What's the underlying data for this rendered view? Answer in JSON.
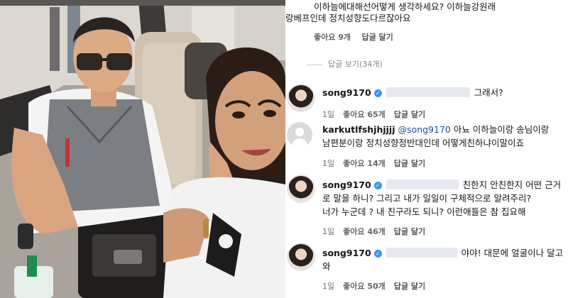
{
  "top_comment": {
    "line1": "이하늘에대해선어떻게 생각하세요? 이하늘강원래",
    "line2": "랑베프인데 정치성향도다르잖아요",
    "likes": "좋아요 9개",
    "reply": "답글 달기"
  },
  "view_replies": "답글 보기(34개)",
  "replies": [
    {
      "username": "song9170",
      "verified": true,
      "text_lines": [
        "그래서?"
      ],
      "time": "1일",
      "likes": "좋아요 65개",
      "reply": "답글 달기"
    },
    {
      "username": "karkutlfshjhjjjj",
      "verified": false,
      "mention": "@song9170",
      "text_lines": [
        "아뇨 이하늘이랑 송님이랑",
        "남편분이랑 정치성향정반대인데 어떻게친하냐이말이죠"
      ],
      "time": "1일",
      "likes": "좋아요 14개",
      "reply": "답글 달기"
    },
    {
      "username": "song9170",
      "verified": true,
      "text_lines": [
        "친한지 안친한지 어떤 근거",
        "로 말을 하니? 그리고 내가 일일이 구체적으로 알려주리?",
        "너가 누군데 ? 내 친구라도 되니? 이런애들은 참 집요해"
      ],
      "time": "1일",
      "likes": "좋아요 46개",
      "reply": "답글 달기"
    },
    {
      "username": "song9170",
      "verified": true,
      "text_lines": [
        "야야! 대문에 얼굴이나 달고",
        "와"
      ],
      "time": "1일",
      "likes": "좋아요 50개",
      "reply": "답글 달기"
    }
  ],
  "colors": {
    "verified_badge": "#3797f0",
    "mention": "#1f4e9a",
    "meta_text": "#6f6f6f",
    "redaction": "#e6e9f0"
  },
  "icons": [
    "verified-badge-icon",
    "default-avatar-icon"
  ]
}
